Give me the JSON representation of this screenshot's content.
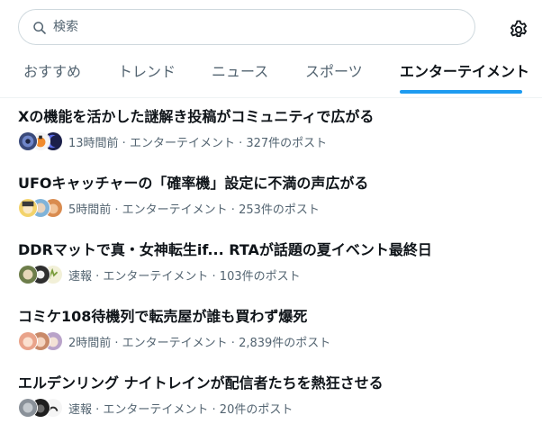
{
  "search": {
    "placeholder": "検索",
    "icon": "search-icon"
  },
  "settings": {
    "icon": "gear-icon"
  },
  "tabs": [
    {
      "label": "おすすめ",
      "active": false
    },
    {
      "label": "トレンド",
      "active": false
    },
    {
      "label": "ニュース",
      "active": false
    },
    {
      "label": "スポーツ",
      "active": false
    },
    {
      "label": "エンターテイメント",
      "active": true
    }
  ],
  "colors": {
    "accent": "#1d9bf0",
    "text_primary": "#0f1419",
    "text_secondary": "#536471"
  },
  "trends": [
    {
      "title": "Xの機能を活かした謎解き投稿がコミュニティで広がる",
      "meta": "13時間前 · エンターテイメント · 327件のポスト"
    },
    {
      "title": "UFOキャッチャーの「確率機」設定に不満の声広がる",
      "meta": "5時間前 · エンターテイメント · 253件のポスト"
    },
    {
      "title": "DDRマットで真・女神転生if... RTAが話題の夏イベント最終日",
      "meta": "速報 · エンターテイメント · 103件のポスト"
    },
    {
      "title": "コミケ108待機列で転売屋が誰も買わず爆死",
      "meta": "2時間前 · エンターテイメント · 2,839件のポスト"
    },
    {
      "title": "エルデンリング ナイトレインが配信者たちを熱狂させる",
      "meta": "速報 · エンターテイメント · 20件のポスト"
    }
  ]
}
